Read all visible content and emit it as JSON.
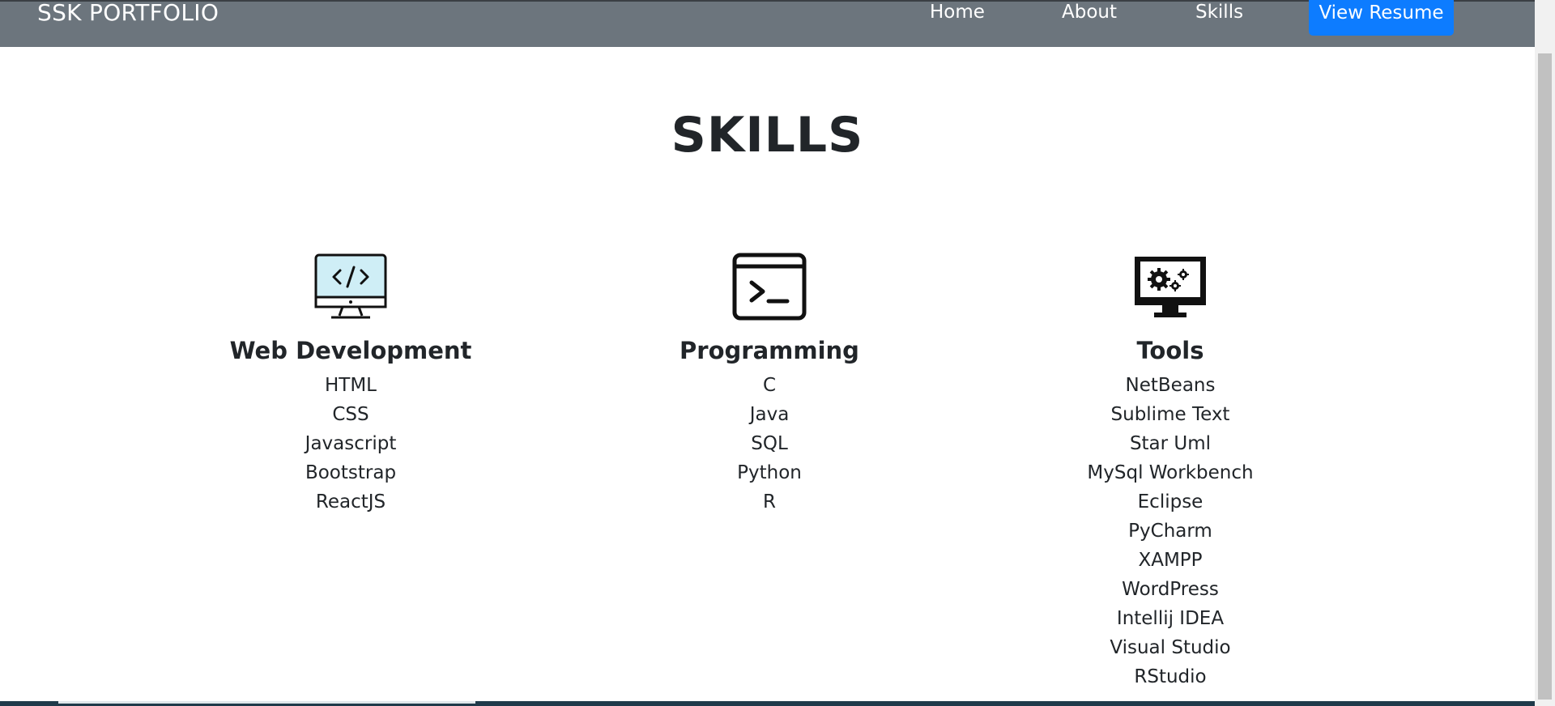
{
  "navbar": {
    "brand": "SSK PORTFOLIO",
    "links": [
      "Home",
      "About",
      "Skills"
    ],
    "resume_button": "View Resume",
    "colors": {
      "background": "#6c757d",
      "button": "#0d7cff"
    }
  },
  "page_title": "SKILLS",
  "columns": [
    {
      "icon": "monitor-code-icon",
      "heading": "Web Development",
      "items": [
        "HTML",
        "CSS",
        "Javascript",
        "Bootstrap",
        "ReactJS"
      ]
    },
    {
      "icon": "terminal-icon",
      "heading": "Programming",
      "items": [
        "C",
        "Java",
        "SQL",
        "Python",
        "R"
      ]
    },
    {
      "icon": "monitor-gears-icon",
      "heading": "Tools",
      "items": [
        "NetBeans",
        "Sublime Text",
        "Star Uml",
        "MySql Workbench",
        "Eclipse",
        "PyCharm",
        "XAMPP",
        "WordPress",
        "Intellij IDEA",
        "Visual Studio",
        "RStudio"
      ]
    }
  ]
}
